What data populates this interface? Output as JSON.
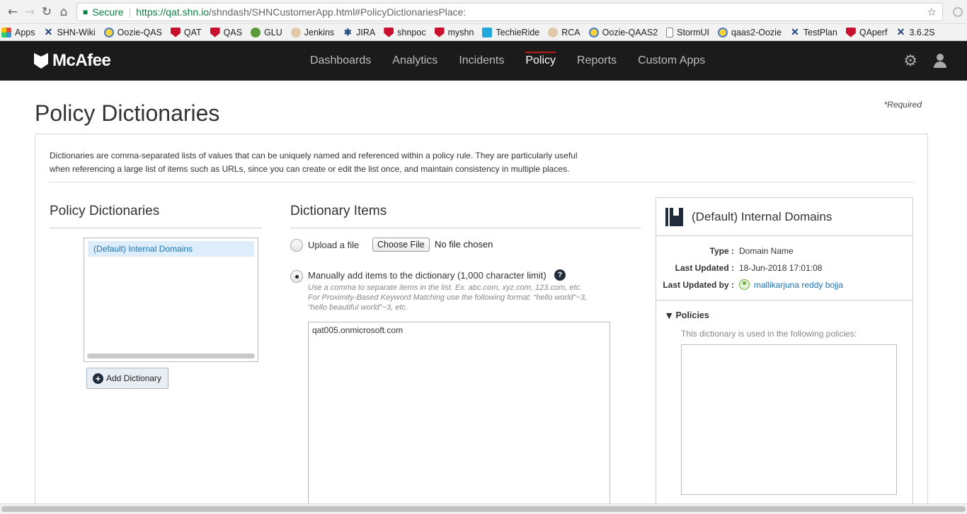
{
  "browser": {
    "secure_label": "Secure",
    "url_host": "https://qat.shn.io",
    "url_path": "/shndash/SHNCustomerApp.html#PolicyDictionariesPlace:"
  },
  "bookmarks": [
    {
      "label": "Apps",
      "icon": "apps-grid-icon"
    },
    {
      "label": "SHN-Wiki",
      "icon": "x-icon"
    },
    {
      "label": "Oozie-QAS",
      "icon": "oozie-icon"
    },
    {
      "label": "QAT",
      "icon": "mcafee-shield-icon"
    },
    {
      "label": "QAS",
      "icon": "mcafee-shield-icon"
    },
    {
      "label": "GLU",
      "icon": "glu-icon"
    },
    {
      "label": "Jenkins",
      "icon": "jenkins-icon"
    },
    {
      "label": "JIRA",
      "icon": "jira-icon"
    },
    {
      "label": "shnpoc",
      "icon": "mcafee-shield-icon"
    },
    {
      "label": "myshn",
      "icon": "mcafee-shield-icon"
    },
    {
      "label": "TechieRide",
      "icon": "techieride-icon"
    },
    {
      "label": "RCA",
      "icon": "jenkins-icon"
    },
    {
      "label": "Oozie-QAAS2",
      "icon": "oozie-icon"
    },
    {
      "label": "StormUI",
      "icon": "document-icon"
    },
    {
      "label": "qaas2-Oozie",
      "icon": "oozie-icon"
    },
    {
      "label": "TestPlan",
      "icon": "x-icon"
    },
    {
      "label": "QAperf",
      "icon": "mcafee-shield-icon"
    },
    {
      "label": "3.6.2S",
      "icon": "x-icon"
    }
  ],
  "header": {
    "logo": "McAfee",
    "nav": [
      {
        "label": "Dashboards",
        "active": false
      },
      {
        "label": "Analytics",
        "active": false
      },
      {
        "label": "Incidents",
        "active": false
      },
      {
        "label": "Policy",
        "active": true
      },
      {
        "label": "Reports",
        "active": false
      },
      {
        "label": "Custom Apps",
        "active": false
      }
    ],
    "accent_color": "#c01818"
  },
  "page": {
    "title": "Policy Dictionaries",
    "required_note": "*Required",
    "intro_line1": "Dictionaries are comma-separated lists of values that can be uniquely named and referenced within a policy rule. They are particularly useful",
    "intro_line2": "when referencing a large list of items such as URLs, since you can create or edit the list once, and maintain consistency in multiple places."
  },
  "dictionaries": {
    "heading": "Policy Dictionaries",
    "items": [
      "(Default) Internal Domains"
    ],
    "add_button": "Add Dictionary"
  },
  "items_panel": {
    "heading": "Dictionary Items",
    "upload_label": "Upload a file",
    "choose_file": "Choose File",
    "no_file": "No file chosen",
    "manual_label": "Manually add items to the dictionary (1,000 character limit)",
    "help_glyph": "?",
    "hint_line1": "Use a comma to separate items in the list. Ex. abc.com, xyz.com, 123.com, etc.",
    "hint_line2": "For Proximity-Based Keyword Matching use the following format: “hello world”~3,",
    "hint_line3": "“hello beautiful world”~3, etc.",
    "content": "qat005.onmicrosoft.com",
    "selected_option": "manual"
  },
  "detail": {
    "title": "(Default) Internal Domains",
    "type_label": "Type :",
    "type_value": "Domain Name",
    "updated_label": "Last Updated :",
    "updated_value": "18-Jun-2018 17:01:08",
    "updated_by_label": "Last Updated by :",
    "updated_by_value": "mallikarjuna reddy bojja",
    "policies_heading": "Policies",
    "policies_note": "This dictionary is used in the following policies:"
  }
}
